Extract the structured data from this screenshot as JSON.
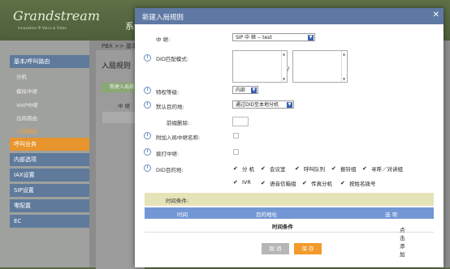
{
  "app": {
    "logo_text": "Grandstream",
    "logo_subtitle": "Innovative IP Voice & Video",
    "header_text": "系统"
  },
  "sidebar": {
    "items": [
      {
        "label": "基本/呼叫路由",
        "type": "main"
      },
      {
        "label": "分机",
        "type": "sub"
      },
      {
        "label": "模拟中继",
        "type": "sub"
      },
      {
        "label": "VoIP中继",
        "type": "sub"
      },
      {
        "label": "出局路由",
        "type": "sub"
      },
      {
        "label": "入局路由",
        "type": "sub",
        "active": true
      },
      {
        "label": "呼叫业务",
        "type": "main",
        "highlight": true
      },
      {
        "label": "内部选项",
        "type": "main"
      },
      {
        "label": "IAX设置",
        "type": "main"
      },
      {
        "label": "SIP设置",
        "type": "main"
      },
      {
        "label": "零配置",
        "type": "main"
      },
      {
        "label": "EC",
        "type": "main"
      }
    ]
  },
  "background_page": {
    "breadcrumb": "PBX >> 基本",
    "title": "入局规则",
    "button": "新建入局规",
    "column": "中 继"
  },
  "dialog": {
    "title": "新建入局规则",
    "close_icon": "close-icon",
    "fields": {
      "trunk_label": "中 继:",
      "trunk_value": "SIP 中 继 -- test",
      "did_pattern_label": "DID匹配模式:",
      "did_separator": "/",
      "privilege_label": "特权等级:",
      "privilege_value": "内部",
      "default_dest_label": "默认目的地:",
      "default_dest_value": "通过DID至本地分机",
      "strip_label": "前缀删除:",
      "prepend_name_label": "附加入局中继名称:",
      "dial_trunk_label": "拨打中继:",
      "did_dest_label": "DID目的地:"
    },
    "did_destinations": [
      {
        "label": "分 机",
        "checked": true
      },
      {
        "label": "会议室",
        "checked": true
      },
      {
        "label": "呼叫队列",
        "checked": true
      },
      {
        "label": "振铃组",
        "checked": true
      },
      {
        "label": "寻呼／对讲组",
        "checked": true
      },
      {
        "label": "IVR",
        "checked": true
      },
      {
        "label": "语音信箱组",
        "checked": true
      },
      {
        "label": "传真分机",
        "checked": true
      },
      {
        "label": "按姓名拨号",
        "checked": true
      }
    ],
    "time_conditions": {
      "header": "时间条件:",
      "columns": [
        "时间",
        "目的地址",
        "选 项"
      ],
      "add_text_prefix": "点击添加",
      "add_text_link": "时间条件"
    },
    "buttons": {
      "cancel": "取 消",
      "save": "保 存"
    }
  },
  "colors": {
    "dialog_title_bg": "#5f79a4",
    "table_header_bg": "#7297d4",
    "cond_header_bg": "#e5e3b8",
    "save_bg": "#f29a2c",
    "cancel_bg": "#b6b6b6",
    "sidebar_main_bg": "#5f7a9b",
    "sidebar_highlight_bg": "#e8952d"
  }
}
